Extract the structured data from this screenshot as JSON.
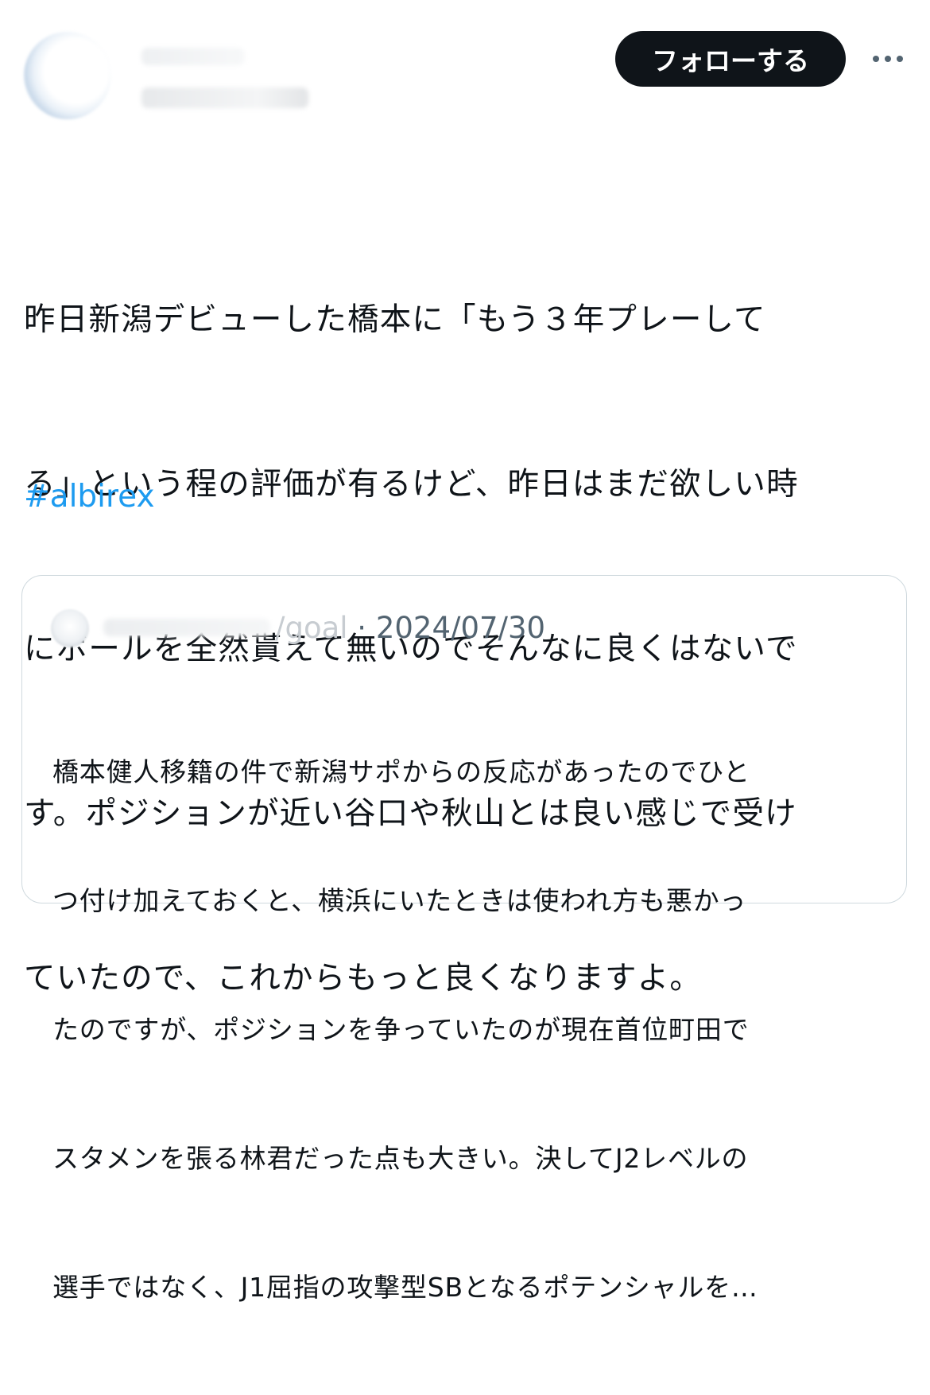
{
  "author": {
    "avatar_icon": "user-avatar-icon"
  },
  "follow_button": "フォローする",
  "more_icon": "more-options-icon",
  "tweet": {
    "lines": [
      "昨日新潟デビューした橋本に「もう３年プレーして",
      "る」という程の評価が有るけど、昨日はまだ欲しい時",
      "にボールを全然貰えて無いのでそんなに良くはないで",
      "す。ポジションが近い谷口や秋山とは良い感じで受け",
      "ていたので、これからもっと良くなりますよ。"
    ],
    "hashtag": "#albirex"
  },
  "quote": {
    "handle": "/goal",
    "separator": " · ",
    "date": "2024/07/30",
    "lines": [
      "橋本健人移籍の件で新潟サポからの反応があったのでひと",
      "つ付け加えておくと、横浜にいたときは使われ方も悪かっ",
      "たのですが、ポジションを争っていたのが現在首位町田で",
      "スタメンを張る林君だった点も大きい。決してJ2レベルの",
      "選手ではなく、J1屈指の攻撃型SBとなるポテンシャルを…"
    ]
  },
  "colors": {
    "accent": "#1d9bf0",
    "text": "#0f1419",
    "secondary": "#536471",
    "border": "#cfd9de"
  }
}
